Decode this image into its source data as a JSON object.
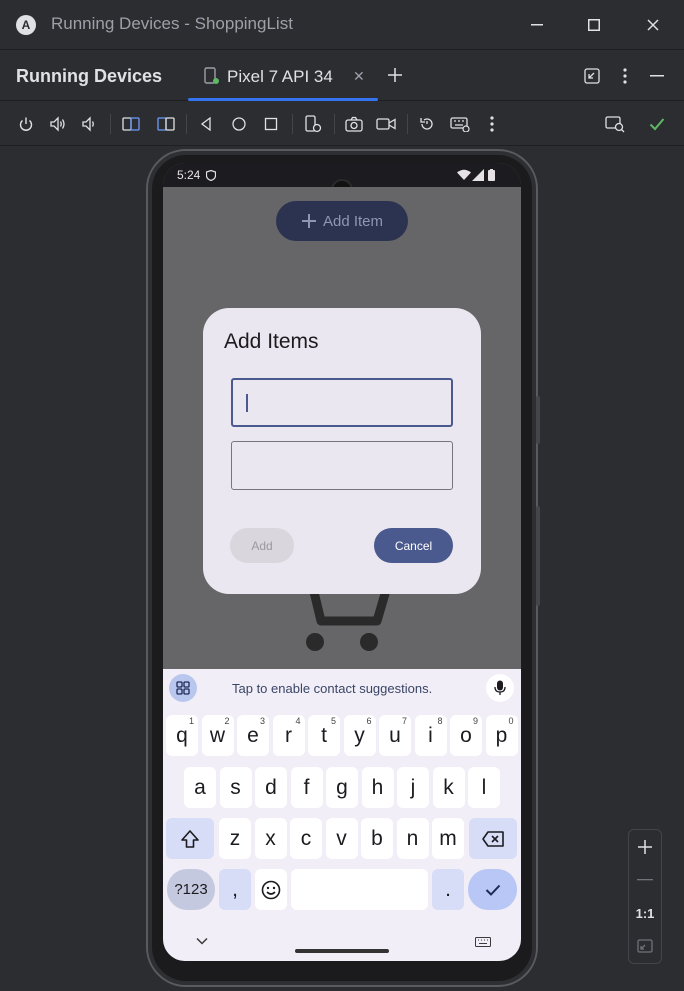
{
  "window": {
    "title": "Running Devices - ShoppingList",
    "logo_letter": "A"
  },
  "tool": {
    "title": "Running Devices",
    "tab_label": "Pixel 7 API 34"
  },
  "toolbar": {
    "icons": [
      "power-icon",
      "volume-up-icon",
      "volume-down-icon",
      "rotate-left-icon",
      "rotate-right-icon",
      "back-icon",
      "home-icon",
      "overview-icon",
      "device-settings-icon",
      "screenshot-icon",
      "screen-record-icon",
      "reset-icon",
      "keyboard-icon",
      "more-icon",
      "device-mirror-icon",
      "check-icon"
    ]
  },
  "device": {
    "status_time": "5:24",
    "app": {
      "add_item_button": "Add Item"
    },
    "dialog": {
      "title": "Add Items",
      "name_field_value": "",
      "quantity_field_value": "",
      "add_label": "Add",
      "cancel_label": "Cancel"
    },
    "keyboard": {
      "suggestion_text": "Tap to enable contact suggestions.",
      "row1": [
        {
          "k": "q",
          "s": "1"
        },
        {
          "k": "w",
          "s": "2"
        },
        {
          "k": "e",
          "s": "3"
        },
        {
          "k": "r",
          "s": "4"
        },
        {
          "k": "t",
          "s": "5"
        },
        {
          "k": "y",
          "s": "6"
        },
        {
          "k": "u",
          "s": "7"
        },
        {
          "k": "i",
          "s": "8"
        },
        {
          "k": "o",
          "s": "9"
        },
        {
          "k": "p",
          "s": "0"
        }
      ],
      "row2": [
        "a",
        "s",
        "d",
        "f",
        "g",
        "h",
        "j",
        "k",
        "l"
      ],
      "row3": [
        "z",
        "x",
        "c",
        "v",
        "b",
        "n",
        "m"
      ],
      "sym_label": "?123",
      "comma_label": ",",
      "period_label": "."
    }
  },
  "zoom_panel": {
    "one_to_one_label": "1:1"
  },
  "colors": {
    "accent_blue": "#3574f0",
    "dialog_primary": "#4a5a8e",
    "success_green": "#5fb865"
  }
}
